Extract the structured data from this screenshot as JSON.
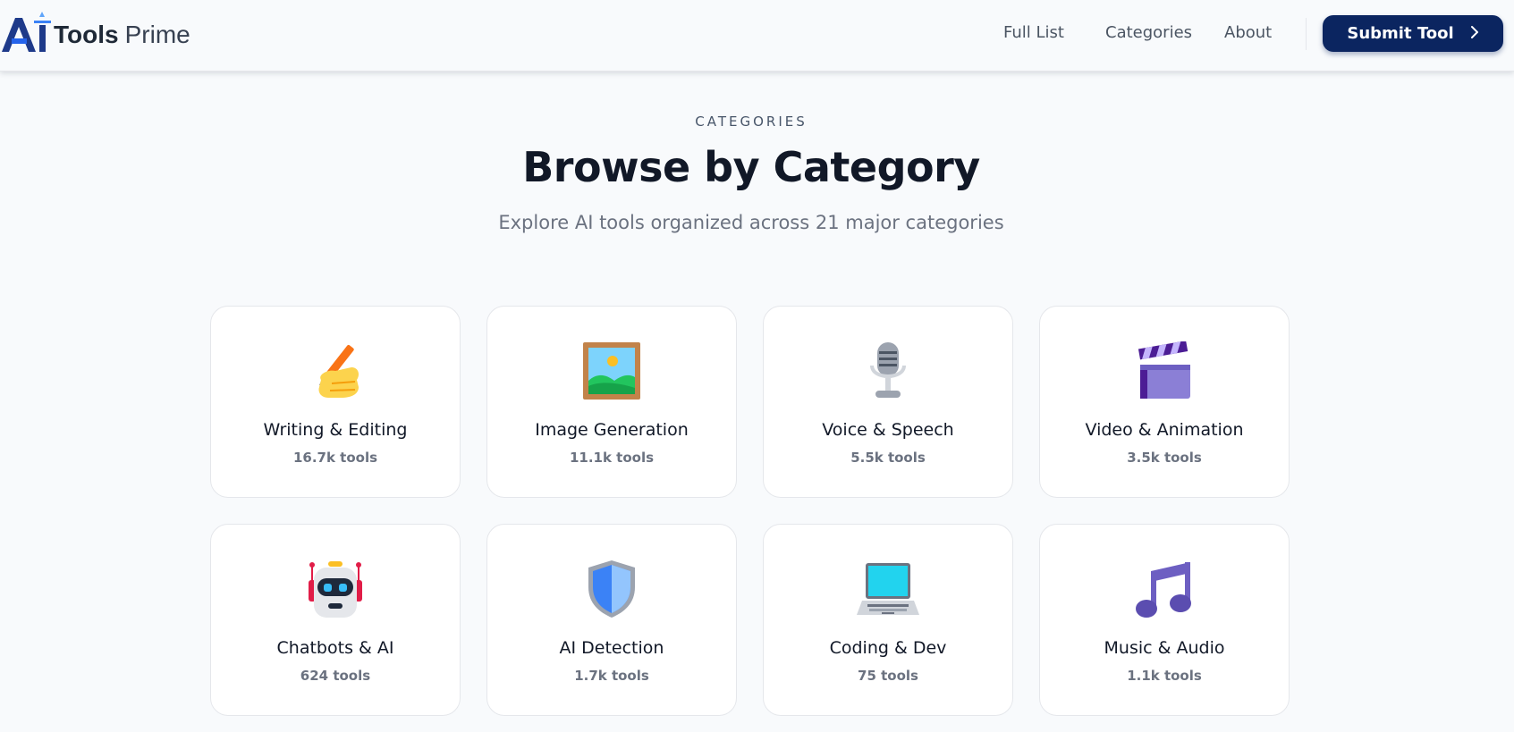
{
  "brand": {
    "logo_mark": "AI",
    "name_bold": "Tools",
    "name_light": "Prime"
  },
  "nav": {
    "items": [
      {
        "label": "Full List"
      },
      {
        "label": "Categories"
      },
      {
        "label": "About"
      }
    ],
    "submit_label": "Submit Tool",
    "submit_icon": "chevron-right-icon"
  },
  "hero": {
    "eyebrow": "CATEGORIES",
    "title": "Browse by Category",
    "subtitle": "Explore AI tools organized across 21 major categories"
  },
  "categories": [
    {
      "name": "Writing & Editing",
      "count": "16.7k tools",
      "icon": "writing-hand-icon"
    },
    {
      "name": "Image Generation",
      "count": "11.1k tools",
      "icon": "framed-picture-icon"
    },
    {
      "name": "Voice & Speech",
      "count": "5.5k tools",
      "icon": "microphone-icon"
    },
    {
      "name": "Video & Animation",
      "count": "3.5k tools",
      "icon": "clapper-board-icon"
    },
    {
      "name": "Chatbots & AI",
      "count": "624 tools",
      "icon": "robot-icon"
    },
    {
      "name": "AI Detection",
      "count": "1.7k tools",
      "icon": "shield-icon"
    },
    {
      "name": "Coding & Dev",
      "count": "75 tools",
      "icon": "laptop-icon"
    },
    {
      "name": "Music & Audio",
      "count": "1.1k tools",
      "icon": "musical-notes-icon"
    }
  ],
  "colors": {
    "accent": "#0b2560",
    "background": "#f8fafc",
    "card": "#ffffff",
    "muted_text": "#6b7280"
  }
}
